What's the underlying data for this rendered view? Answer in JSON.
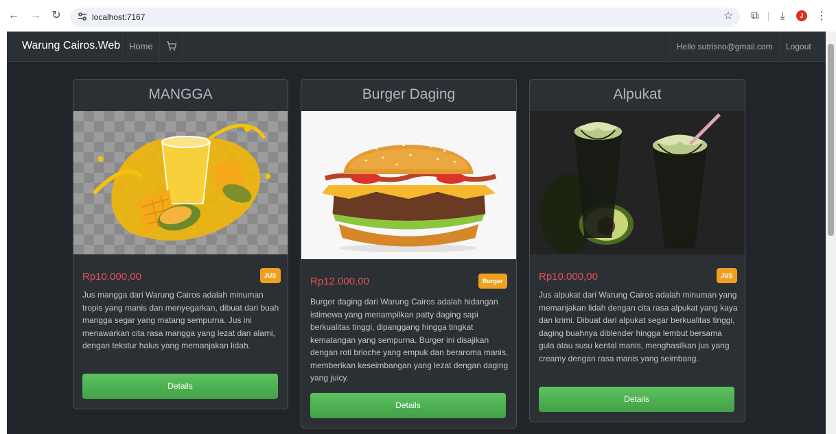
{
  "browser": {
    "url": "localhost:7167",
    "profile_initial": "J"
  },
  "navbar": {
    "brand": "Warung Cairos.Web",
    "home": "Home",
    "greeting": "Hello sutrisno@gmail.com",
    "logout": "Logout"
  },
  "products": [
    {
      "title": "MANGGA",
      "price": "Rp10.000,00",
      "badge": "JUS",
      "description": "Jus mangga dari Warung Cairos adalah minuman tropis yang manis dan menyegarkan, dibuat dari buah mangga segar yang matang sempurna. Jus ini menawarkan cita rasa mangga yang lezat dan alami, dengan tekstur halus yang memanjakan lidah.",
      "button": "Details"
    },
    {
      "title": "Burger Daging",
      "price": "Rp12.000,00",
      "badge": "Burger",
      "description": "Burger daging dari Warung Cairos adalah hidangan istimewa yang menampilkan patty daging sapi berkualitas tinggi, dipanggang hingga tingkat kematangan yang sempurna. Burger ini disajikan dengan roti brioche yang empuk dan beraroma manis, memberikan keseimbangan yang lezat dengan daging yang juicy.",
      "button": "Details"
    },
    {
      "title": "Alpukat",
      "price": "Rp10.000,00",
      "badge": "JUS",
      "description": "Jus alpukat dari Warung Cairos adalah minuman yang memanjakan lidah dengan cita rasa alpukat yang kaya dan krimi. Dibuat dari alpukat segar berkualitas tinggi, daging buahnya diblender hingga lembut bersama gula atau susu kental manis, menghasilkan jus yang creamy dengan rasa manis yang seimbang.",
      "button": "Details"
    }
  ],
  "colors": {
    "page_bg": "#212529",
    "navbar_bg": "#2b3035",
    "price": "#e55353",
    "badge": "#f0a020",
    "button": "#4caf50"
  }
}
